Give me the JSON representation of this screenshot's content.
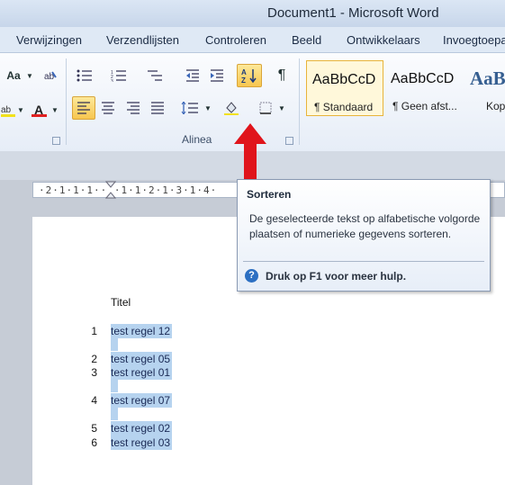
{
  "window": {
    "title": "Document1 - Microsoft Word"
  },
  "tabs": [
    "Verwijzingen",
    "Verzendlijsten",
    "Controleren",
    "Beeld",
    "Ontwikkelaars",
    "Invoegtoepa"
  ],
  "ribbon": {
    "font_size_label": "Aa",
    "group_paragraph_label": "Alinea",
    "sort_button_label": "A↓Z",
    "pilcrow": "¶",
    "font_color_label": "A"
  },
  "styles": [
    {
      "preview": "AaBbCcD",
      "name": "¶ Standaard"
    },
    {
      "preview": "AaBbCcD",
      "name": "¶ Geen afst..."
    },
    {
      "preview": "AaB",
      "name": "Kop"
    }
  ],
  "ruler": {
    "ticks": "·2·1·1·1·· ·1·1·2·1·3·1·4·"
  },
  "tooltip": {
    "title": "Sorteren",
    "body": "De geselecteerde tekst op alfabetische volgorde plaatsen of numerieke gegevens sorteren.",
    "help": "Druk op F1 voor meer hulp."
  },
  "document": {
    "title": "Titel",
    "lines": [
      {
        "num": "1",
        "text": "test regel 12"
      },
      {
        "num": "",
        "text": ""
      },
      {
        "num": "2",
        "text": "test regel 05"
      },
      {
        "num": "3",
        "text": "test regel 01"
      },
      {
        "num": "",
        "text": ""
      },
      {
        "num": "4",
        "text": "test regel 07"
      },
      {
        "num": "",
        "text": ""
      },
      {
        "num": "5",
        "text": "test regel 02"
      },
      {
        "num": "6",
        "text": "test regel 03"
      }
    ]
  },
  "colors": {
    "selection": "#b6d3ef",
    "arrow": "#e0141b",
    "highlight": "#f7c64f"
  }
}
